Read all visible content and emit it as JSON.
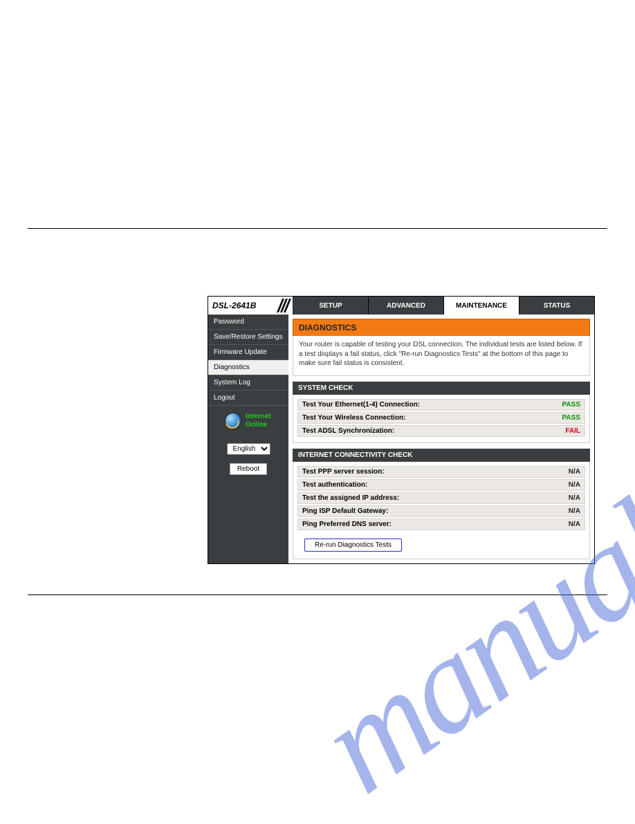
{
  "watermark": "manualshive.com",
  "model": "DSL-2641B",
  "tabs": {
    "setup": "SETUP",
    "advanced": "ADVANCED",
    "maintenance": "MAINTENANCE",
    "status": "STATUS"
  },
  "sidebar": {
    "items": {
      "password": "Password",
      "save_restore": "Save/Restore Settings",
      "firmware": "Firmware Update",
      "diagnostics": "Diagnostics",
      "system_log": "System Log",
      "logout": "Logout"
    },
    "status_line1": "Internet",
    "status_line2": "Online",
    "language": "English",
    "reboot": "Reboot"
  },
  "panel": {
    "title": "DIAGNOSTICS",
    "description": "Your router is capable of testing your DSL connection. The individual tests are listed below. If a test displays a fail status, click \"Re-run Diagnostics Tests\" at the bottom of this page to make sure fail status is consistent."
  },
  "system_check": {
    "title": "SYSTEM CHECK",
    "rows": {
      "ethernet": {
        "label": "Test Your Ethernet(1-4) Connection:",
        "status": "PASS"
      },
      "wireless": {
        "label": "Test Your Wireless Connection:",
        "status": "PASS"
      },
      "adsl": {
        "label": "Test ADSL Synchronization:",
        "status": "FAIL"
      }
    }
  },
  "connectivity": {
    "title": "INTERNET CONNECTIVITY CHECK",
    "rows": {
      "ppp": {
        "label": "Test PPP server session:",
        "status": "N/A"
      },
      "auth": {
        "label": "Test authentication:",
        "status": "N/A"
      },
      "ip": {
        "label": "Test the assigned IP address:",
        "status": "N/A"
      },
      "gw": {
        "label": "Ping ISP Default Gateway:",
        "status": "N/A"
      },
      "dns": {
        "label": "Ping Preferred DNS server:",
        "status": "N/A"
      }
    },
    "rerun_button": "Re-run Diagnostics Tests"
  }
}
